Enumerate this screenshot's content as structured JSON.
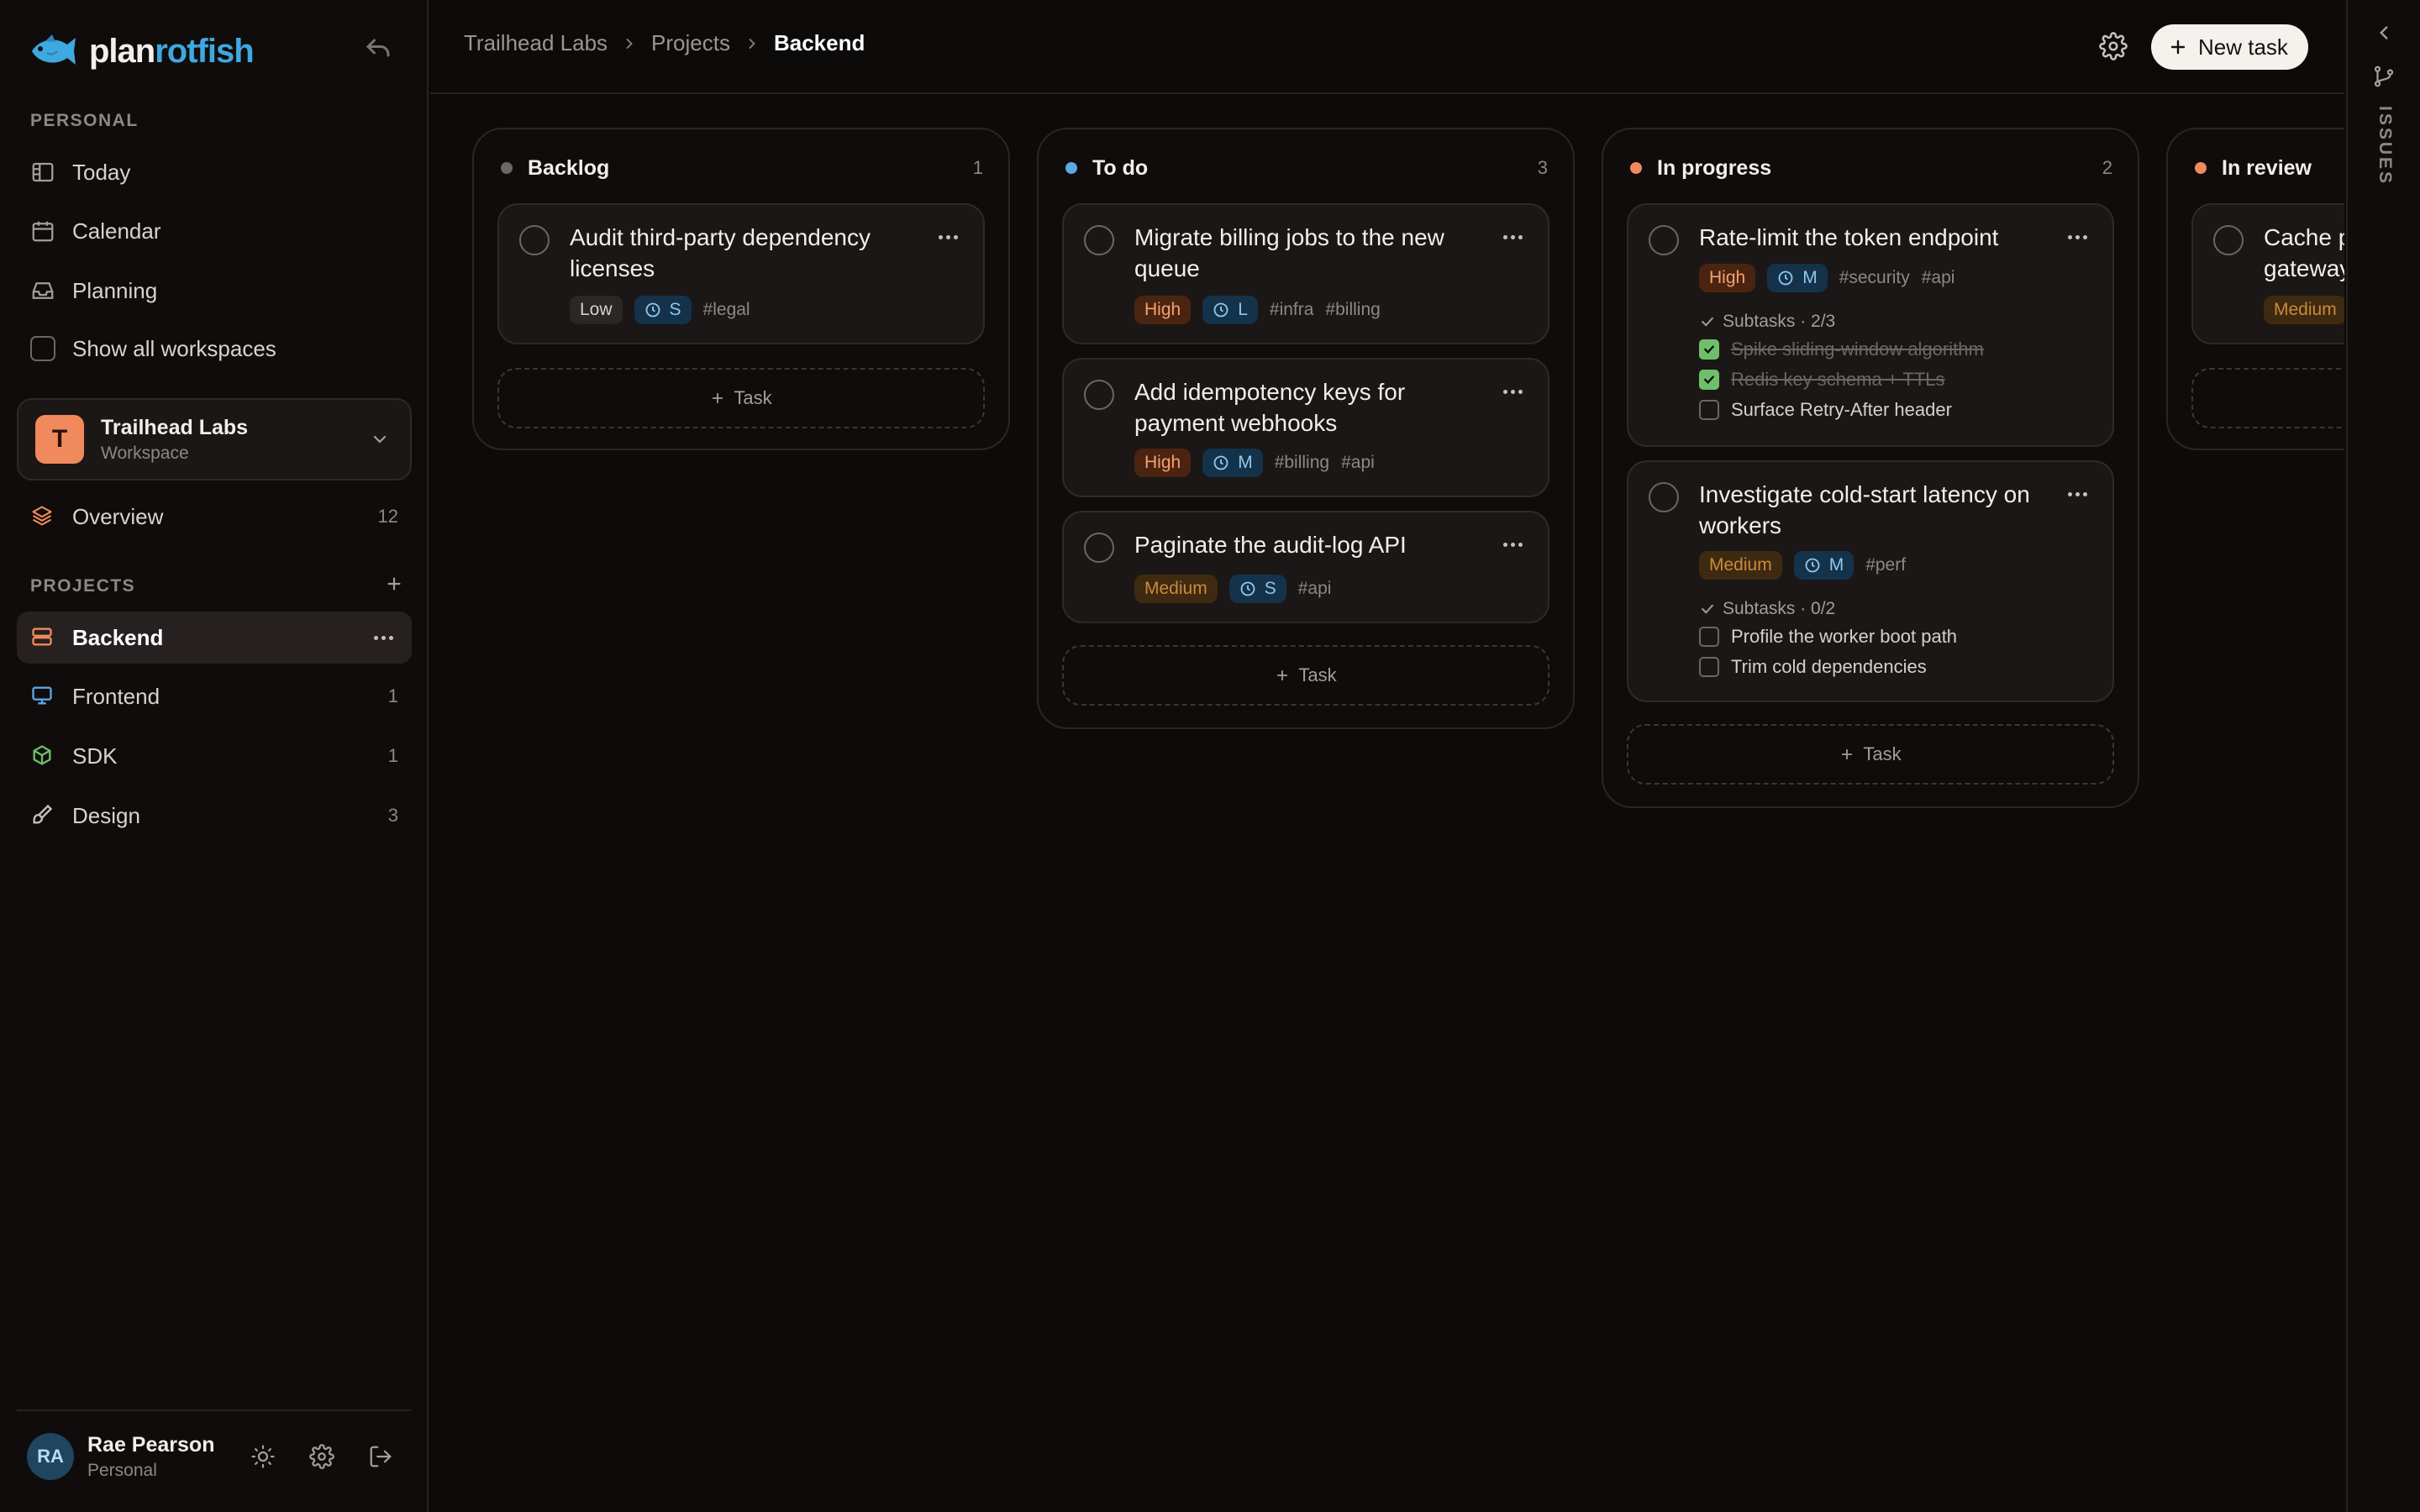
{
  "brand": {
    "name_part1": "plan",
    "name_part2": "rotfish"
  },
  "sidebar": {
    "personal_label": "PERSONAL",
    "personal_items": [
      {
        "label": "Today",
        "icon": "today-panel-icon"
      },
      {
        "label": "Calendar",
        "icon": "calendar-icon"
      },
      {
        "label": "Planning",
        "icon": "inbox-tray-icon"
      }
    ],
    "show_all_label": "Show all workspaces",
    "workspace": {
      "initial": "T",
      "name": "Trailhead Labs",
      "sub": "Workspace"
    },
    "overview": {
      "label": "Overview",
      "count": "12"
    },
    "projects_label": "PROJECTS",
    "projects": [
      {
        "label": "Backend",
        "count": "",
        "color": "#f08a5d",
        "active": true
      },
      {
        "label": "Frontend",
        "count": "1",
        "color": "#5aa8e6"
      },
      {
        "label": "SDK",
        "count": "1",
        "color": "#6fbf6a"
      },
      {
        "label": "Design",
        "count": "3",
        "color": "#c8c1ba"
      }
    ],
    "user": {
      "initials": "RA",
      "name": "Rae Pearson",
      "sub": "Personal"
    }
  },
  "header": {
    "breadcrumb": [
      "Trailhead Labs",
      "Projects",
      "Backend"
    ],
    "new_task_label": "New task"
  },
  "board": {
    "add_task_label": "Task",
    "columns": [
      {
        "title": "Backlog",
        "count": "1",
        "dot_color": "#6d6661",
        "cards": [
          {
            "title": "Audit third-party dependency licenses",
            "priority": "Low",
            "size": "S",
            "tags": [
              "#legal"
            ]
          }
        ]
      },
      {
        "title": "To do",
        "count": "3",
        "dot_color": "#5aa8e6",
        "cards": [
          {
            "title": "Migrate billing jobs to the new queue",
            "priority": "High",
            "size": "L",
            "tags": [
              "#infra",
              "#billing"
            ]
          },
          {
            "title": "Add idempotency keys for payment webhooks",
            "priority": "High",
            "size": "M",
            "tags": [
              "#billing",
              "#api"
            ]
          },
          {
            "title": "Paginate the audit-log API",
            "priority": "Medium",
            "size": "S",
            "tags": [
              "#api"
            ]
          }
        ]
      },
      {
        "title": "In progress",
        "count": "2",
        "dot_color": "#f08a5d",
        "cards": [
          {
            "title": "Rate-limit the token endpoint",
            "priority": "High",
            "size": "M",
            "tags": [
              "#security",
              "#api"
            ],
            "subtasks_label": "Subtasks · 2/3",
            "subtasks": [
              {
                "label": "Spike sliding-window algorithm",
                "done": true
              },
              {
                "label": "Redis key schema + TTLs",
                "done": true
              },
              {
                "label": "Surface Retry-After header",
                "done": false
              }
            ]
          },
          {
            "title": "Investigate cold-start latency on workers",
            "priority": "Medium",
            "size": "M",
            "tags": [
              "#perf"
            ],
            "subtasks_label": "Subtasks · 0/2",
            "subtasks": [
              {
                "label": "Profile the worker boot path",
                "done": false
              },
              {
                "label": "Trim cold dependencies",
                "done": false
              }
            ]
          }
        ]
      },
      {
        "title": "In review",
        "count": "",
        "dot_color": "#f08a5d",
        "cards": [
          {
            "title": "Cache p gateway",
            "priority": "Medium",
            "size": "",
            "tags": []
          }
        ]
      }
    ]
  },
  "rail": {
    "label": "ISSUES"
  }
}
